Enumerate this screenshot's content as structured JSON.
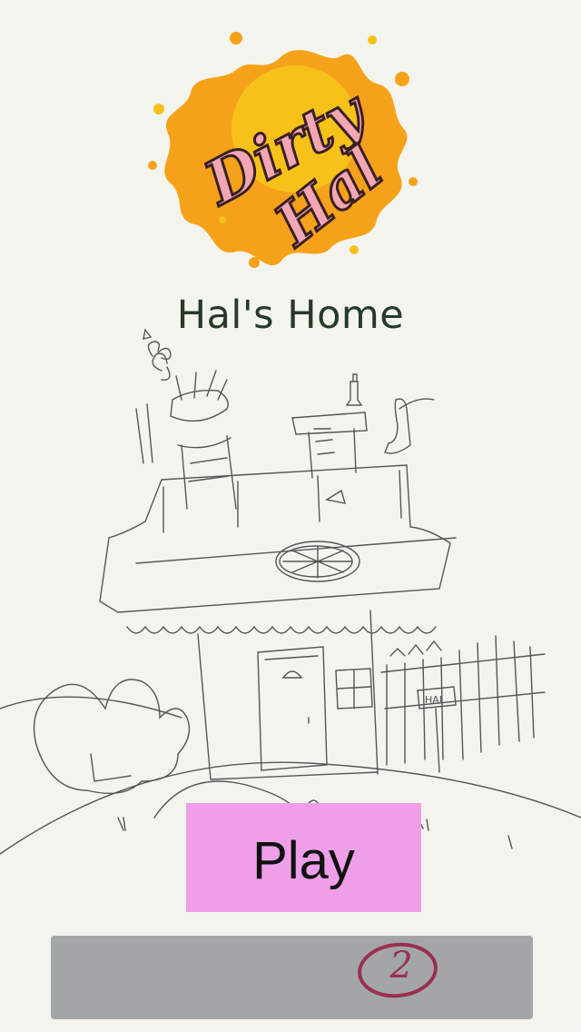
{
  "logo": {
    "line1": "Dirty",
    "line2": "Hal",
    "splash_color": "#f5a21a",
    "text_color": "#f2a7b2"
  },
  "level": {
    "title": "Hal's Home",
    "sign_text": "HAL"
  },
  "play_button": {
    "label": "Play",
    "color": "#ee9fe8"
  },
  "bottom_bar": {
    "badge_value": "2",
    "color": "#a3a6a9"
  }
}
